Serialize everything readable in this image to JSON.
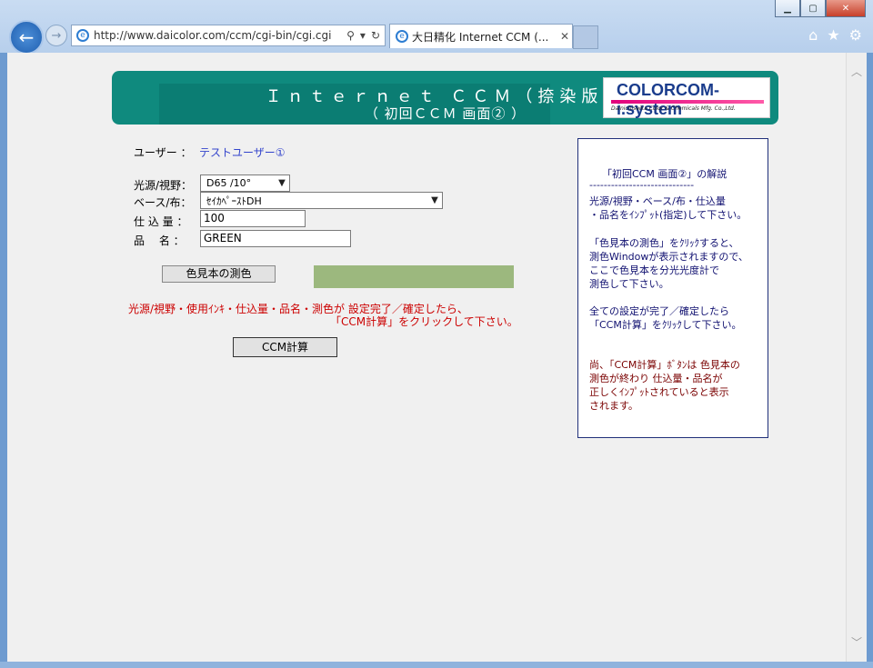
{
  "browser": {
    "address_url": "http://www.daicolor.com/ccm/cgi-bin/cgi.cgi",
    "tab_title": "大日精化 Internet CCM (...",
    "window_buttons": [
      "minimize-icon",
      "maximize-icon",
      "close-icon"
    ],
    "toolbar_icons": [
      "home-icon",
      "star-icon",
      "gear-icon"
    ]
  },
  "banner": {
    "title": "Ｉｎｔｅｒｎｅｔ ＣＣＭ（捺染版）",
    "subtitle": "（ 初回ＣＣＭ 画面② ）",
    "logo_text": "COLORCOM-i.system",
    "logo_subtext": "Dainichiseika Color & Chemicals Mfg. Co.,Ltd."
  },
  "form": {
    "user_label": "ユーザー ：",
    "user_value": "テストユーザー①",
    "light_label": "光源/視野：",
    "light_value": "D65 /10°",
    "base_label": "ベース/布：",
    "base_value": "ｾｲｶﾍﾟｰｽﾄDH",
    "amount_label": "仕 込 量 ：",
    "amount_value": "100",
    "product_label": "品　 名 ：",
    "product_value": "GREEN",
    "measure_button": "色見本の測色",
    "measured_color": "#9cb87e",
    "instruction_line1": "光源/視野・使用ｲﾝｷ・仕込量・品名・測色が 設定完了／確定したら、",
    "instruction_line2": "「CCM計算」をクリックして下さい。",
    "calc_button": "CCM計算"
  },
  "panel": {
    "heading": "「初回CCM 画面②」の解説",
    "divider": "-----------------------------",
    "lines_block1": [
      "光源/視野・ベース/布・仕込量",
      "・品名をｲﾝﾌﾟｯﾄ(指定)して下さい。"
    ],
    "lines_block2": [
      "「色見本の測色」をｸﾘｯｸすると、",
      "  測色Windowが表示されますので、",
      "  ここで色見本を分光光度計で",
      "  測色して下さい。"
    ],
    "lines_block3": [
      "全ての設定が完了／確定したら",
      "  「CCM計算」をｸﾘｯｸして下さい。"
    ],
    "lines_block4": [
      "尚、「CCM計算」ﾎﾞﾀﾝは 色見本の",
      "  測色が終わり 仕込量・品名が",
      "  正しくｲﾝﾌﾟｯﾄされていると表示",
      "  されます。"
    ]
  }
}
